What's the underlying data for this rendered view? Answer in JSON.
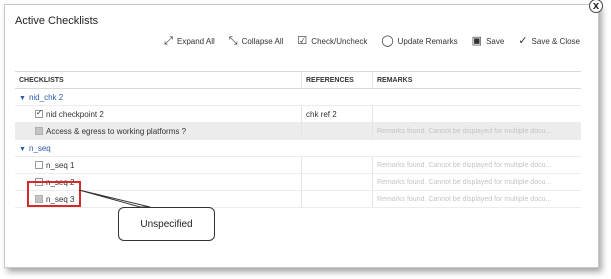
{
  "dialog": {
    "title": "Active Checklists",
    "close_glyph": "x"
  },
  "toolbar": {
    "expand_all": "Expand All",
    "collapse_all": "Collapse All",
    "check_uncheck": "Check/Uncheck",
    "update_remarks": "Update Remarks",
    "save": "Save",
    "save_close": "Save & Close"
  },
  "columns": {
    "checklists": "CHECKLISTS",
    "references": "REFERENCES",
    "remarks": "REMARKS"
  },
  "groups": [
    {
      "name": "nid_chk 2",
      "rows": [
        {
          "label": "nid checkpoint 2",
          "reference": "chk ref 2",
          "remarks": "",
          "checked": true
        },
        {
          "label": "Access & egress to working platforms ?",
          "reference": "",
          "remarks": "Remarks found. Cannot be displayed for multiple docu...",
          "checked": false
        }
      ]
    },
    {
      "name": "n_seq",
      "rows": [
        {
          "label": "n_seq 1",
          "reference": "",
          "remarks": "Remarks found. Cannot be displayed for multiple docu...",
          "checked": false
        },
        {
          "label": "n_seq 2",
          "reference": "",
          "remarks": "Remarks found. Cannot be displayed for multiple docu...",
          "checked": false
        },
        {
          "label": "n_seq 3",
          "reference": "",
          "remarks": "Remarks found. Cannot be displayed for multiple docu...",
          "checked": false
        }
      ]
    }
  ],
  "annotation": {
    "callout_text": "Unspecified",
    "highlight_color": "#d52a2a"
  },
  "icons": [
    "expand-all-icon",
    "collapse-all-icon",
    "check-uncheck-icon",
    "update-remarks-icon",
    "save-icon",
    "save-close-icon",
    "close-icon",
    "caret-down-icon"
  ]
}
